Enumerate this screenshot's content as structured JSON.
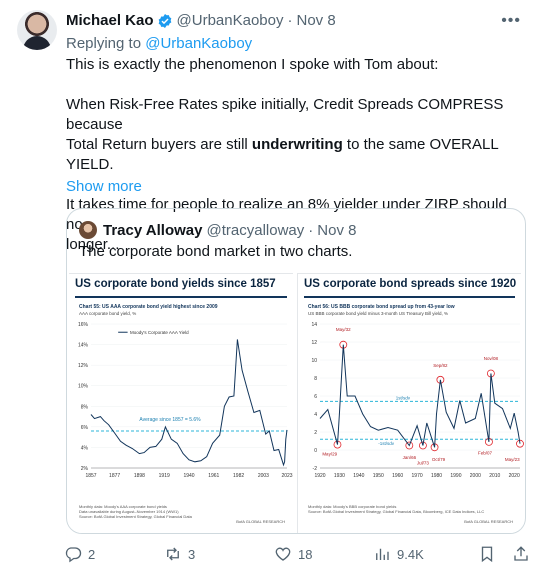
{
  "tweet": {
    "author_name": "Michael Kao",
    "author_handle": "@UrbanKaoboy",
    "dot": "·",
    "date": "Nov 8",
    "replying_prefix": "Replying to",
    "replying_to": "@UrbanKaoboy",
    "line1": "This is exactly the phenomenon I spoke with Tom about:",
    "line2a": "When Risk-Free Rates spike initially, Credit Spreads COMPRESS because",
    "line2b": "Total Return buyers are still ",
    "line2_bold": "underwriting",
    "line2c": " to the same OVERALL YIELD.",
    "line3a": "It takes time for people to realize an 8% yielder under ZIRP should no",
    "line3b": "longer...",
    "show_more": "Show more"
  },
  "quote": {
    "author_name": "Tracy Alloway",
    "author_handle": "@tracyalloway",
    "dot": "·",
    "date": "Nov 8",
    "text": "The corporate bond market in two charts."
  },
  "left_chart_text": {
    "title": "US corporate bond yields since 1857",
    "chart_label": "Chart 55: US AAA corporate bond yield highest since 2009",
    "chart_sub": "AAA corporate bond yield, %",
    "legend": "Moody's Corporate AAA Yield",
    "average_label": "Average since 1857 = 5.6%",
    "foot1": "Monthly data: Moody's AAA corporate bond yields",
    "foot2": "Data unavailable during August–November 1914 (WW1)",
    "foot3": "Source:  BofA Global Investment Strategy, Global Financial Data",
    "foot_right": "BofA GLOBAL RESEARCH"
  },
  "right_chart_text": {
    "title": "US corporate bond spreads since 1920",
    "chart_label": "Chart 56: US BBB corporate bond spread up from 43-year low",
    "chart_sub": "US BBB corporate bond yield minus 3-month US Treasury Bill yield, %",
    "plus_sd": "1st/sdv",
    "minus_sd": "-1st/sdv",
    "foot1": "Monthly data: Moody's BBB corporate bond yields",
    "foot2": "Source:  BofA Global Investment Strategy, Global Financial Data, Bloomberg, ICE Data Indices, LLC",
    "foot_right": "BofA GLOBAL RESEARCH"
  },
  "chart_data": [
    {
      "type": "line",
      "title": "US corporate bond yields since 1857",
      "subtitle": "Chart 55: US AAA corporate bond yield highest since 2009",
      "ylabel": "AAA corporate bond yield, %",
      "xlim": [
        1857,
        2023
      ],
      "ylim": [
        2,
        16
      ],
      "x_ticks": [
        "1857",
        "1877",
        "1898",
        "1919",
        "1940",
        "1961",
        "1982",
        "2003",
        "2023"
      ],
      "y_ticks": [
        "2%",
        "4%",
        "6%",
        "8%",
        "10%",
        "12%",
        "14%",
        "16%"
      ],
      "average_line": 5.6,
      "series": [
        {
          "name": "Moody's Corporate AAA Yield",
          "x": [
            1857,
            1860,
            1865,
            1868,
            1872,
            1877,
            1882,
            1887,
            1892,
            1898,
            1902,
            1907,
            1912,
            1917,
            1920,
            1925,
            1930,
            1935,
            1940,
            1945,
            1950,
            1955,
            1960,
            1966,
            1970,
            1974,
            1978,
            1981,
            1985,
            1990,
            1995,
            2000,
            2005,
            2008,
            2012,
            2016,
            2020,
            2021,
            2022,
            2023
          ],
          "y": [
            7.2,
            6.8,
            7.0,
            6.6,
            6.2,
            5.4,
            4.6,
            4.2,
            3.9,
            3.4,
            3.5,
            4.0,
            4.1,
            4.8,
            6.0,
            4.8,
            4.4,
            3.4,
            2.8,
            2.6,
            2.7,
            3.1,
            4.4,
            5.2,
            8.0,
            8.9,
            9.0,
            14.5,
            11.5,
            9.4,
            7.4,
            7.6,
            5.3,
            5.6,
            3.7,
            3.8,
            2.3,
            2.6,
            4.8,
            5.7
          ]
        }
      ]
    },
    {
      "type": "line",
      "title": "US corporate bond spreads since 1920",
      "subtitle": "Chart 56: US BBB corporate bond spread up from 43-year low",
      "ylabel": "US BBB corporate bond yield minus 3-month US Treasury Bill yield, %",
      "xlim": [
        1920,
        2023
      ],
      "ylim": [
        -2,
        14
      ],
      "x_ticks": [
        "1920",
        "1930",
        "1940",
        "1950",
        "1960",
        "1970",
        "1980",
        "1990",
        "2000",
        "2010",
        "2020"
      ],
      "y_ticks": [
        "-2",
        "0",
        "2",
        "4",
        "6",
        "8",
        "10",
        "12",
        "14"
      ],
      "reference_lines": [
        {
          "label": "1st/sdv",
          "value": 5.4
        },
        {
          "label": "-1st/sdv",
          "value": 1.2
        }
      ],
      "annotations": [
        "May/32",
        "May/29",
        "Sep/82",
        "Nov/08",
        "Jan/66",
        "Jul/73",
        "Oct/79",
        "Feb/07",
        "May/23"
      ],
      "series": [
        {
          "name": "",
          "x": [
            1920,
            1924,
            1929,
            1930,
            1932,
            1934,
            1938,
            1942,
            1946,
            1950,
            1955,
            1960,
            1966,
            1970,
            1973,
            1975,
            1979,
            1980,
            1982,
            1985,
            1989,
            1992,
            1995,
            2000,
            2003,
            2007,
            2008,
            2010,
            2014,
            2018,
            2020,
            2022,
            2023
          ],
          "y": [
            3.5,
            4.5,
            0.6,
            4.0,
            11.7,
            6.0,
            6.0,
            4.0,
            2.6,
            2.2,
            2.5,
            2.2,
            0.5,
            2.7,
            0.5,
            3.0,
            0.3,
            4.0,
            7.8,
            4.2,
            2.4,
            5.5,
            3.0,
            3.5,
            6.3,
            0.9,
            8.5,
            5.2,
            4.6,
            2.4,
            4.1,
            2.0,
            0.7
          ]
        }
      ]
    }
  ],
  "actions": {
    "replies": "2",
    "reposts": "3",
    "likes": "18",
    "views": "9.4K"
  },
  "colors": {
    "accent": "#1d9bf0",
    "text": "#0f1419",
    "muted": "#536471",
    "chart_line": "#12355b",
    "average_line": "#2bb5d8",
    "annotation": "#e0242a"
  }
}
